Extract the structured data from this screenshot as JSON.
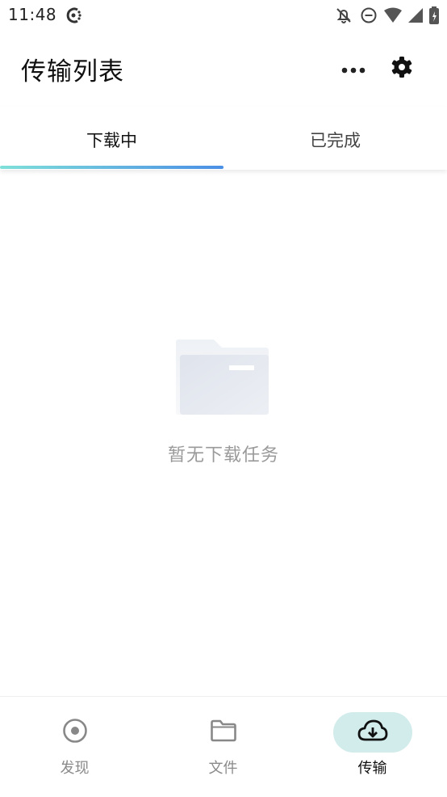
{
  "status_bar": {
    "time": "11:48"
  },
  "header": {
    "title": "传输列表",
    "more_icon": "more-horizontal-icon",
    "settings_icon": "gear-icon"
  },
  "tabs": [
    {
      "label": "下载中",
      "active": true
    },
    {
      "label": "已完成",
      "active": false
    }
  ],
  "empty_state": {
    "icon": "folder-icon",
    "message": "暂无下载任务"
  },
  "bottom_nav": [
    {
      "label": "发现",
      "icon": "discover-target-icon",
      "active": false
    },
    {
      "label": "文件",
      "icon": "folder-icon",
      "active": false
    },
    {
      "label": "传输",
      "icon": "cloud-download-icon",
      "active": true
    }
  ],
  "colors": {
    "tab_indicator_start": "#7fe0d9",
    "tab_indicator_end": "#4a8fe6",
    "active_nav_pill": "#d2ecec",
    "empty_text": "#9a9a9a"
  }
}
